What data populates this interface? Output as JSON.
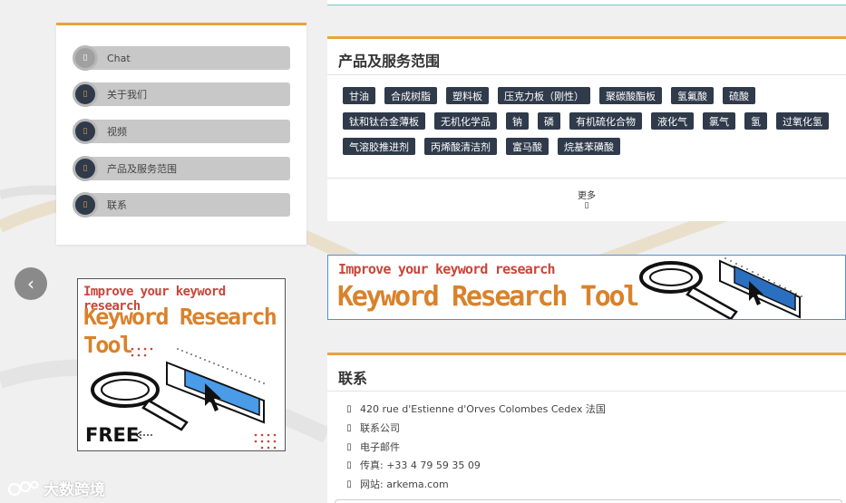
{
  "nav": {
    "items": [
      {
        "label": "Chat",
        "icon": "chat-icon",
        "glyph": "▯",
        "active": true
      },
      {
        "label": "关于我们",
        "icon": "info-icon",
        "glyph": "▯"
      },
      {
        "label": "视频",
        "icon": "video-icon",
        "glyph": "▯"
      },
      {
        "label": "产品及服务范围",
        "icon": "products-icon",
        "glyph": "▯"
      },
      {
        "label": "联系",
        "icon": "contact-icon",
        "glyph": "▯"
      }
    ]
  },
  "carousel": {
    "prev_glyph": "‹"
  },
  "ad_left": {
    "line1": "Improve your keyword research",
    "line2": "Keyword Research Tool",
    "free": "FREE"
  },
  "products": {
    "title": "产品及服务范围",
    "tags": [
      "甘油",
      "合成树脂",
      "塑料板",
      "压克力板（刚性）",
      "聚碳酸酯板",
      "氢氟酸",
      "硫酸",
      "钛和钛合金薄板",
      "无机化学品",
      "钠",
      "磷",
      "有机硫化合物",
      "液化气",
      "氯气",
      "氢",
      "过氧化氢",
      "气溶胶推进剂",
      "丙烯酸清洁剂",
      "富马酸",
      "烷基苯磺酸"
    ],
    "more_label": "更多",
    "more_glyph": "▯"
  },
  "ad_right": {
    "line1": "Improve your keyword research",
    "line2": "Keyword Research Tool"
  },
  "contact": {
    "title": "联系",
    "rows": [
      {
        "icon": "location-icon",
        "glyph": "▯",
        "text": "420 rue d'Estienne d'Orves Colombes Cedex 法国"
      },
      {
        "icon": "company-icon",
        "glyph": "▯",
        "text": "联系公司"
      },
      {
        "icon": "email-icon",
        "glyph": "▯",
        "text": "电子邮件"
      },
      {
        "icon": "fax-icon",
        "glyph": "▯",
        "text": "传真: +33 4 79 59 35 09"
      },
      {
        "icon": "website-icon",
        "glyph": "▯",
        "text": "网站: arkema.com"
      }
    ]
  },
  "watermark": {
    "text": "大数跨境"
  },
  "colors": {
    "accent": "#e8a33d",
    "tag_bg": "#2f3a4a",
    "nav_bar": "#c8c8c8",
    "ad_border": "#4a90d9",
    "ad_red": "#c8463a",
    "ad_orange": "#d9822b"
  }
}
